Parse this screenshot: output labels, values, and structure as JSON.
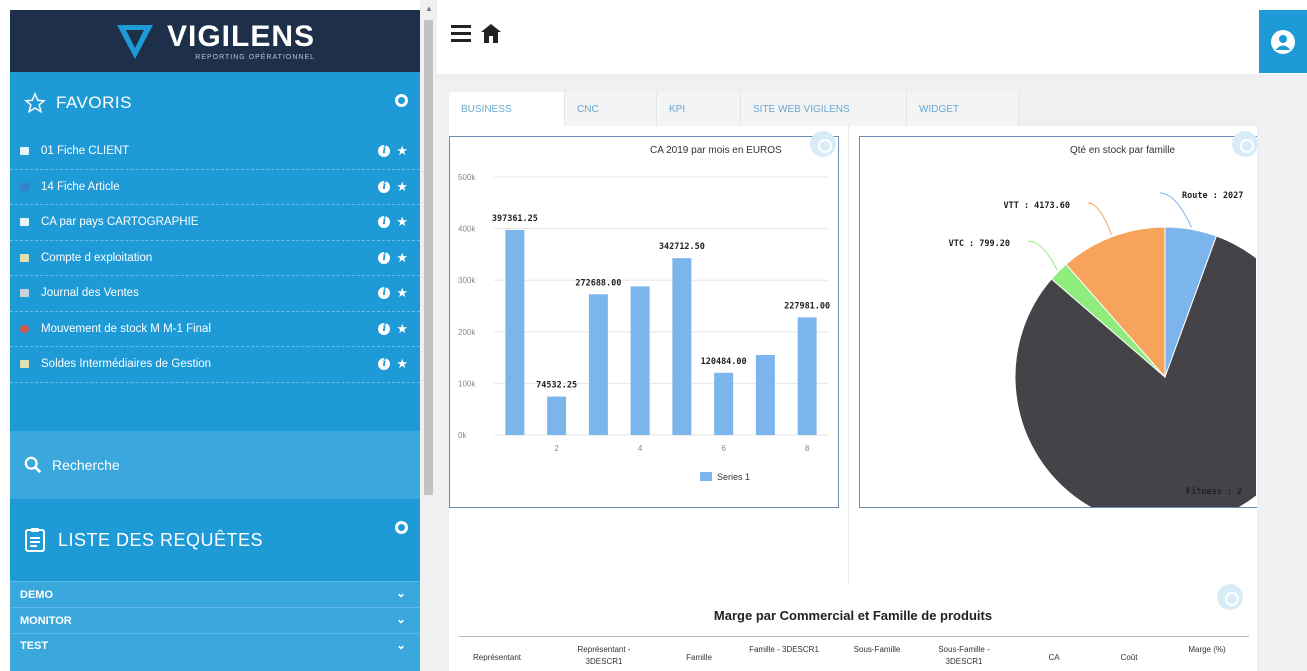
{
  "logo": {
    "name": "VIGILENS",
    "tagline": "REPORTING OPÉRATIONNEL"
  },
  "favoris": {
    "title": "FAVORIS",
    "items": [
      {
        "label": "01 Fiche CLIENT",
        "icon": "table-icon"
      },
      {
        "label": "14 Fiche Article",
        "icon": "chart-icon"
      },
      {
        "label": "CA par pays CARTOGRAPHIE",
        "icon": "map-icon"
      },
      {
        "label": "Compte d exploitation",
        "icon": "document-icon"
      },
      {
        "label": "Journal des Ventes",
        "icon": "journal-icon"
      },
      {
        "label": "Mouvement de stock M M-1 Final",
        "icon": "stock-icon"
      },
      {
        "label": "Soldes Intermédiaires de Gestion",
        "icon": "document-icon"
      }
    ]
  },
  "search": {
    "label": "Recherche"
  },
  "requetes": {
    "title": "LISTE DES REQUÊTES",
    "groups": [
      "DEMO",
      "MONITOR",
      "TEST"
    ]
  },
  "tabs": [
    "BUSINESS",
    "CNC",
    "KPI",
    "SITE WEB VIGILENS",
    "WIDGET"
  ],
  "active_tab": "BUSINESS",
  "colors": {
    "sidebar": "#1e9ad6",
    "logo_bg": "#1e2f4a",
    "bar": "#7cb5ec",
    "pie_fitness": "#434348",
    "pie_vtt": "#f7a35c",
    "pie_vtc": "#90ed7d",
    "pie_route": "#7cb5ec"
  },
  "chart_data": [
    {
      "type": "bar",
      "title": "CA 2019 par mois en EUROS",
      "x": [
        1,
        2,
        3,
        4,
        5,
        6,
        7,
        8
      ],
      "series": [
        {
          "name": "Series 1",
          "values": [
            397361.25,
            74532.25,
            272688.0,
            288000,
            342712.5,
            120484.0,
            155000,
            227981.0
          ]
        }
      ],
      "data_labels": [
        "397361.25",
        "74532.25",
        "272688.00",
        "",
        "342712.50",
        "120484.00",
        "",
        "227981.00"
      ],
      "x_ticks": [
        "2",
        "4",
        "6",
        "8"
      ],
      "y_ticks": [
        "500k",
        "400k",
        "300k",
        "200k",
        "100k",
        "0k"
      ],
      "ylim": [
        0,
        500000
      ],
      "grid": true,
      "legend": "bottom"
    },
    {
      "type": "pie",
      "title": "Qté en stock par famille",
      "labels": [
        "Route : 2027",
        "VTT : 4173.60",
        "VTC : 799.20",
        "Fitness : 2"
      ],
      "values": [
        2027,
        4173.6,
        799.2,
        29400
      ]
    }
  ],
  "table": {
    "title": "Marge par Commercial et Famille de produits",
    "headers": [
      "Représentant",
      "Représentant - 3DESCR1",
      "Famille",
      "Famille - 3DESCR1",
      "Sous-Famille",
      "Sous-Famille - 3DESCR1",
      "CA",
      "Coût",
      "Marge (%)"
    ]
  }
}
